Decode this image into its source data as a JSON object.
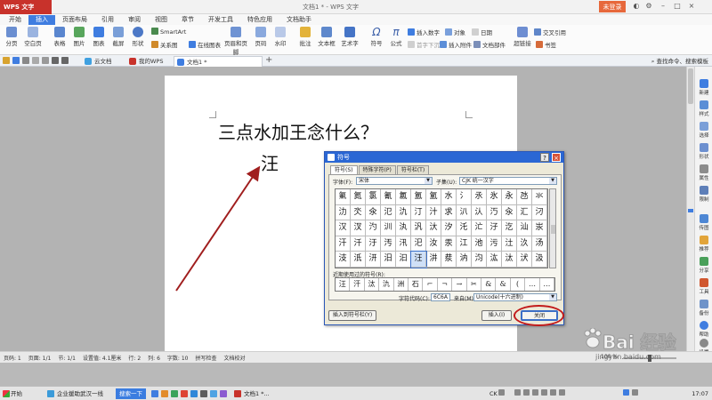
{
  "titlebar": {
    "app_label": "WPS 文字",
    "title": "文档1 * - WPS 文字",
    "login": "未登录"
  },
  "menu": [
    "开始",
    "插入",
    "页面布局",
    "引用",
    "审阅",
    "视图",
    "章节",
    "开发工具",
    "特色应用",
    "文档助手"
  ],
  "menu_active_index": 1,
  "ribbon": {
    "big": [
      "分页",
      "空白页",
      "表格",
      "图片",
      "图表",
      "截屏",
      "形状",
      "页眉和页脚",
      "页码",
      "水印",
      "批注",
      "文本框",
      "艺术字",
      "符号",
      "公式",
      "超链接",
      "书签"
    ],
    "small": {
      "smartart": "SmartArt",
      "relation": "关系图",
      "online_chart": "在线图表",
      "insert_number": "插入数字",
      "object": "对象",
      "date": "日期",
      "first_drop": "首字下沉",
      "attachment": "插入附件",
      "doc_parts": "文档部件",
      "cross_ref": "交叉引用"
    }
  },
  "doc_tabs": {
    "cloud": "云文档",
    "mywps": "我的WPS",
    "doc": "文档1 *",
    "find": "查找命令、搜索模板"
  },
  "document": {
    "line1": "三点水加王念什么？",
    "line2": "汪"
  },
  "right_panel": [
    "新建",
    "样式",
    "选择",
    "形状",
    "属性",
    "限制",
    "传图",
    "推荐",
    "分享",
    "工具",
    "备份",
    "帮助",
    "设置"
  ],
  "dialog": {
    "title": "符号",
    "help": "?",
    "close": "×",
    "tabs": [
      "符号(S)",
      "特殊字符(P)",
      "符号栏(T)"
    ],
    "font_label": "字体(F):",
    "font_value": "宋体",
    "subset_label": "子集(U):",
    "subset_value": "CJK 统一汉字",
    "grid": [
      [
        "氭",
        "氮",
        "氯",
        "氰",
        "氱",
        "氲",
        "氳",
        "水",
        "氵",
        "氶",
        "氷",
        "永",
        "氹",
        "氺"
      ],
      [
        "氻",
        "氼",
        "氽",
        "氾",
        "氿",
        "汀",
        "汁",
        "求",
        "汃",
        "汄",
        "汅",
        "汆",
        "汇",
        "汈"
      ],
      [
        "汉",
        "汊",
        "汋",
        "汌",
        "汍",
        "汎",
        "汏",
        "汐",
        "汑",
        "汒",
        "汓",
        "汔",
        "汕",
        "汖"
      ],
      [
        "汗",
        "汘",
        "汙",
        "汚",
        "汛",
        "汜",
        "汝",
        "汞",
        "江",
        "池",
        "污",
        "汢",
        "汣",
        "汤"
      ],
      [
        "汥",
        "汦",
        "汧",
        "汨",
        "汩",
        "汪",
        "汫",
        "汬",
        "汭",
        "汮",
        "汯",
        "汰",
        "汱",
        "汲"
      ]
    ],
    "selected_cell": "汪",
    "recent_label": "近期使用过的符号(R):",
    "recent": [
      "汪",
      "汗",
      "汰",
      "氿",
      "洲",
      "石",
      "⌐",
      "¬",
      "→",
      "✂",
      "&",
      "&",
      "(",
      "…",
      "…"
    ],
    "code_label": "字符代码(C):",
    "code_value": "6C6A",
    "from_label": "来自(M):",
    "from_value": "Unicode(十六进制)",
    "insert_to_bar": "插入到符号栏(Y)",
    "insert": "插入(I)",
    "close_btn": "关闭"
  },
  "statusbar": {
    "page": "页码: 1",
    "pages": "页面: 1/1",
    "section": "节: 1/1",
    "setting": "设置值: 4.1厘米",
    "row": "行: 2",
    "col": "列: 6",
    "words": "字数: 10",
    "spell": "拼写检查",
    "proof": "文档校对",
    "zoom": "100 %"
  },
  "taskbar": {
    "start": "开始",
    "task1": "企业援助武汉一线",
    "search": "搜索一下",
    "task2": "文档1 *...",
    "tray_lang": "CK",
    "clock": "17:07"
  },
  "watermark": {
    "brand": "Bai 经验",
    "url": "jingyan.baidu.com"
  },
  "colors": {
    "accent": "#3f7de0",
    "wps_red": "#c8322b",
    "login_orange": "#e7683b",
    "annotation_red": "#c21a1a"
  }
}
